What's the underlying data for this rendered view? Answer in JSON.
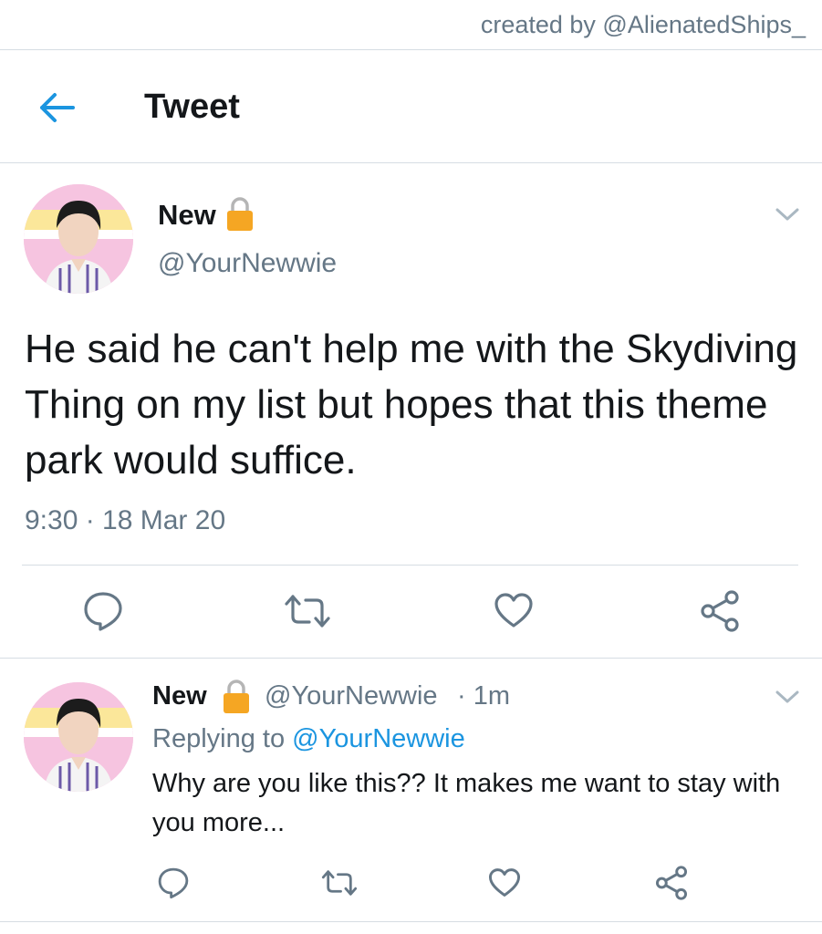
{
  "credit": "created by @AlienatedShips_",
  "header": {
    "title": "Tweet",
    "back_icon": "back-arrow-icon"
  },
  "colors": {
    "accent": "#1b95e0",
    "muted": "#657786",
    "text": "#14171a",
    "lock": "#f5a623"
  },
  "main_tweet": {
    "name": "New",
    "handle": "@YourNewwie",
    "text": "He said he can't help me with the Skydiving Thing on my list but hopes that this theme park would suffice.",
    "time": "9:30 · 18 Mar 20",
    "actions": [
      "reply-icon",
      "retweet-icon",
      "like-icon",
      "share-icon"
    ]
  },
  "reply_tweet": {
    "name": "New",
    "handle": "@YourNewwie",
    "age": "· 1m",
    "replying_prefix": "Replying to",
    "replying_handle": "@YourNewwie",
    "text": "Why are you like this?? It makes me want to stay with you more...",
    "actions": [
      "reply-icon",
      "retweet-icon",
      "like-icon",
      "share-icon"
    ]
  }
}
